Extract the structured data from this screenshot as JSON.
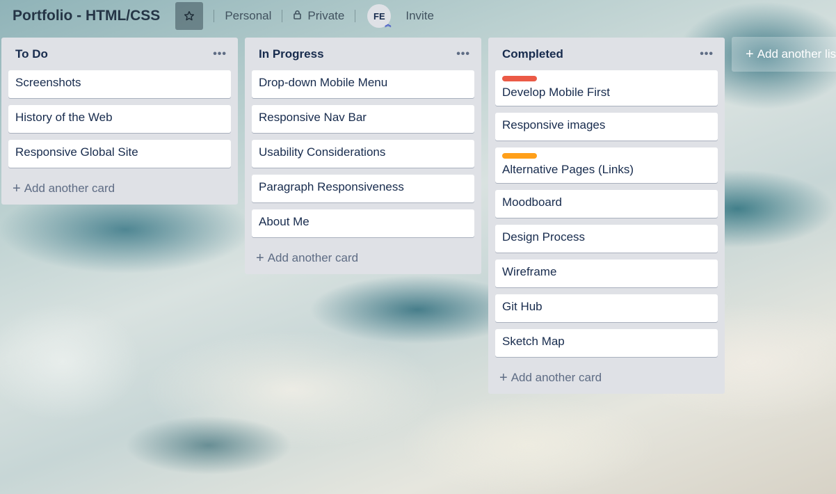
{
  "header": {
    "title": "Portfolio - HTML/CSS",
    "team": "Personal",
    "visibility": "Private",
    "member_initials": "FE",
    "invite": "Invite"
  },
  "lists": [
    {
      "title": "To Do",
      "menu": "•••",
      "cards": [
        {
          "text": "Screenshots"
        },
        {
          "text": "History of the Web"
        },
        {
          "text": "Responsive Global Site"
        }
      ],
      "add_card": "Add another card"
    },
    {
      "title": "In Progress",
      "menu": "•••",
      "cards": [
        {
          "text": "Drop-down Mobile Menu"
        },
        {
          "text": "Responsive Nav Bar"
        },
        {
          "text": "Usability Considerations"
        },
        {
          "text": "Paragraph Responsiveness"
        },
        {
          "text": "About Me"
        }
      ],
      "add_card": "Add another card"
    },
    {
      "title": "Completed",
      "menu": "•••",
      "cards": [
        {
          "text": "Develop Mobile First",
          "label_color": "#eb5a46"
        },
        {
          "text": "Responsive images"
        },
        {
          "text": "Alternative Pages (Links)",
          "label_color": "#ff9f1a"
        },
        {
          "text": "Moodboard"
        },
        {
          "text": "Design Process"
        },
        {
          "text": "Wireframe"
        },
        {
          "text": "Git Hub"
        },
        {
          "text": "Sketch Map"
        }
      ],
      "add_card": "Add another card"
    }
  ],
  "add_list": "Add another list",
  "colors": {
    "list_bg": "#dfe1e6",
    "text": "#172b4d",
    "muted": "#5e6c84"
  }
}
